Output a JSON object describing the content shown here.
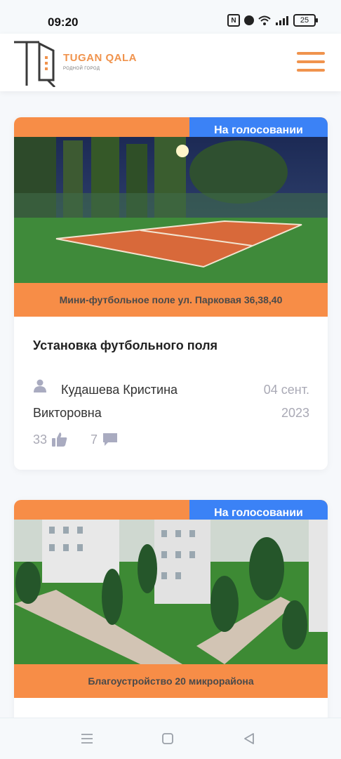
{
  "status_bar": {
    "time": "09:20",
    "battery": "25",
    "nfc": "N"
  },
  "header": {
    "brand_name": "TUGAN QALA",
    "brand_tagline": "РОДНОЙ ГОРОД"
  },
  "cards": [
    {
      "status": "На голосовании",
      "caption": "Мини-футбольное поле ул. Парковая 36,38,40",
      "title": "Установка футбольного поля",
      "author_line1": "Кудашева Кристина",
      "author_line2": "Викторовна",
      "date_line1": "04 сент.",
      "date_line2": "2023",
      "likes": "33",
      "comments": "7"
    },
    {
      "status": "На голосовании",
      "caption": "Благоустройство 20 микрорайона"
    }
  ],
  "colors": {
    "accent": "#f78d47",
    "status": "#3b82f6"
  }
}
